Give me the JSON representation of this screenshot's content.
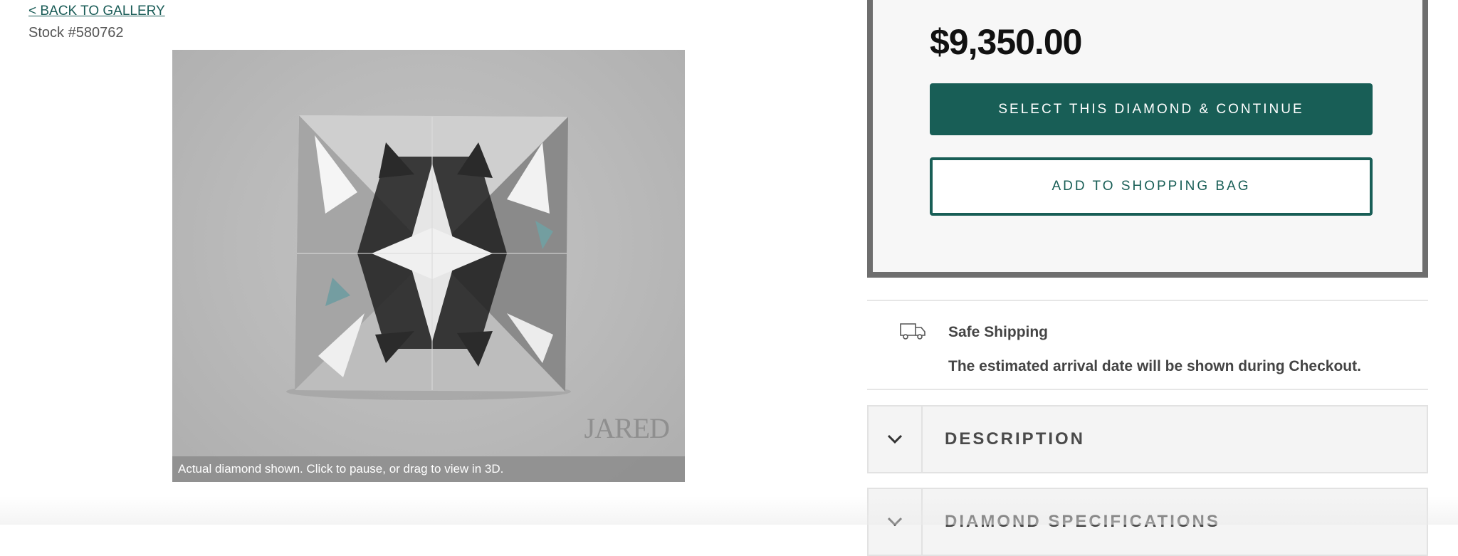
{
  "nav": {
    "back_label": "< BACK TO GALLERY"
  },
  "product": {
    "stock": "Stock #580762",
    "price": "$9,350.00",
    "viewer_caption": "Actual diamond shown. Click to pause, or drag to view in 3D.",
    "watermark": "JARED"
  },
  "actions": {
    "select_label": "SELECT THIS DIAMOND & CONTINUE",
    "bag_label": "ADD TO SHOPPING BAG"
  },
  "shipping": {
    "icon": "truck-icon",
    "title": "Safe Shipping",
    "text": "The estimated arrival date will be shown during Checkout."
  },
  "accordions": [
    {
      "label": "DESCRIPTION",
      "icon": "chevron-down-icon",
      "expanded": false
    },
    {
      "label": "DIAMOND SPECIFICATIONS",
      "icon": "chevron-down-icon",
      "expanded": false
    }
  ],
  "colors": {
    "brand": "#185e56",
    "link": "#1a5c57",
    "panel_border": "#6e6e6e"
  }
}
